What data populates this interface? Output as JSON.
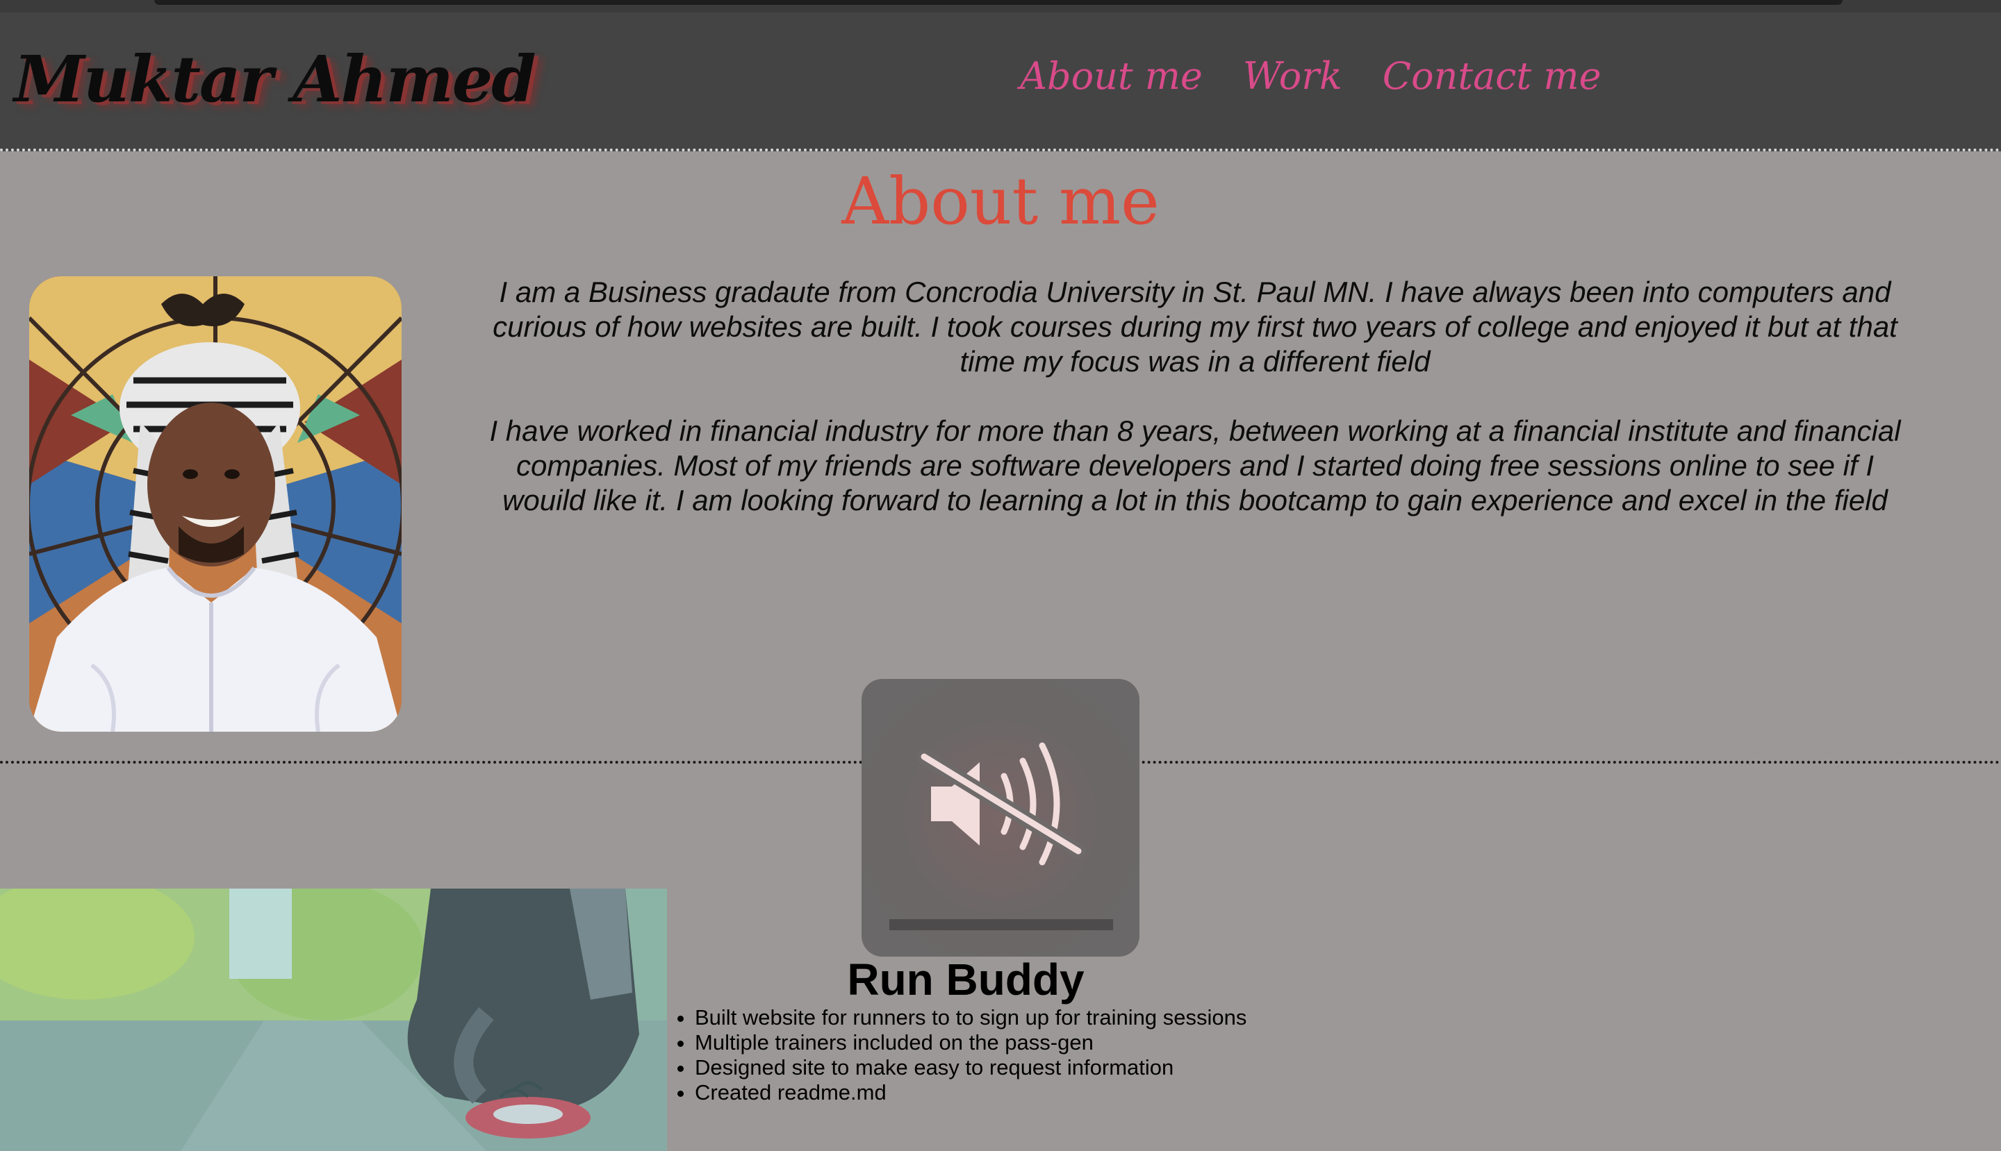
{
  "header": {
    "brand": "Muktar Ahmed",
    "nav": [
      {
        "label": "About me"
      },
      {
        "label": "Work"
      },
      {
        "label": "Contact me"
      }
    ]
  },
  "about": {
    "title": "About me",
    "paragraphs": [
      "I am a Business gradaute from Concrodia University in St. Paul MN. I have always been into computers and curious of how websites are built. I took courses during my first two years of college and enjoyed it but at that time my focus was in a different field",
      "I have worked in financial industry for more than 8 years, between working at a financial institute and financial companies. Most of my friends are software developers and I started doing free sessions online to see if I wouild like it. I am looking forward to learning a lot in this bootcamp to gain experience and excel in the field"
    ]
  },
  "overlay": {
    "icon": "speaker-muted-icon",
    "volume_level": 0
  },
  "work": {
    "project_title": "Run Buddy",
    "bullets": [
      "Built website for runners to to sign up for training sessions",
      "Multiple trainers included on the pass-gen",
      "Designed site to make easy to request information",
      "Created readme.md"
    ]
  },
  "colors": {
    "page_bg": "#9c9897",
    "header_bg": "#444444",
    "nav_link": "#d94b8a",
    "about_title": "#db4a3a"
  }
}
